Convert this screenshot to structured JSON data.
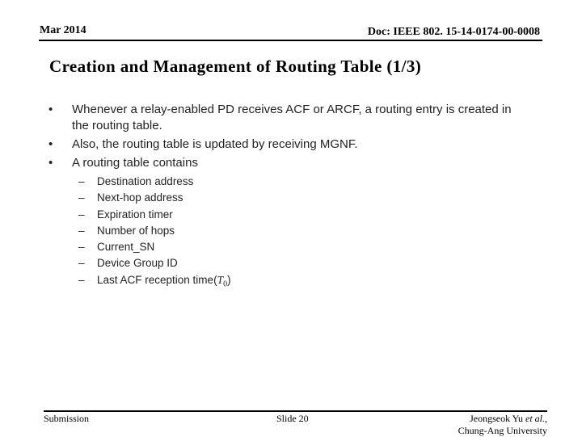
{
  "header": {
    "date": "Mar 2014",
    "doc_id": "Doc: IEEE 802. 15-14-0174-00-0008"
  },
  "slide": {
    "title": "Creation and Management of Routing Table (1/3)",
    "bullet_marker": "•",
    "sub_marker": "–",
    "bullets": [
      "Whenever a relay-enabled PD receives ACF or ARCF, a routing entry is created in the routing table.",
      "Also, the routing table is updated by receiving MGNF.",
      "A routing table contains"
    ],
    "sub_items": [
      "Destination address",
      "Next-hop address",
      "Expiration timer",
      "Number of hops",
      "Current_SN",
      "Device Group ID",
      "Last  ACF reception time("
    ],
    "last_item_symbol": "T",
    "last_item_subscript": "0",
    "last_item_close": ")"
  },
  "footer": {
    "left": "Submission",
    "center": "Slide 20",
    "author": "Jeongseok Yu ",
    "author_etal": "et al.",
    "author_comma": ",",
    "affiliation": "Chung-Ang University"
  }
}
